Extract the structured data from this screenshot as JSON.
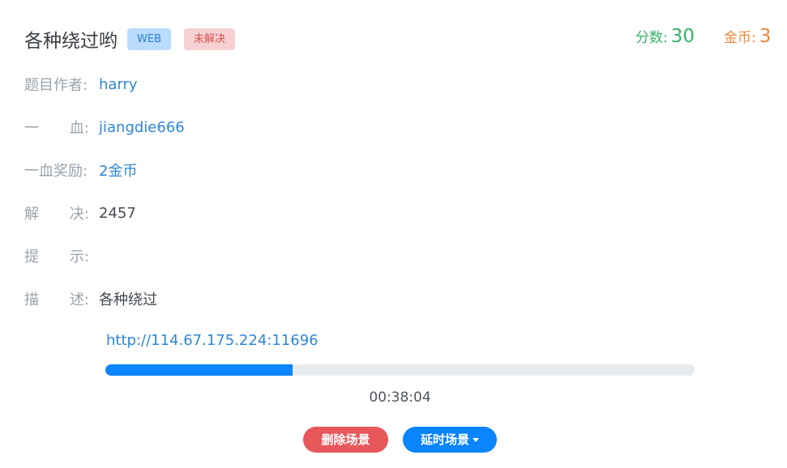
{
  "challenge": {
    "title": "各种绕过哟",
    "category_badge": "WEB",
    "status_badge": "未解决"
  },
  "stats": {
    "score_label": "分数:",
    "score_value": "30",
    "coin_label": "金币:",
    "coin_value": "3"
  },
  "info": [
    {
      "label_chars": [
        "题目作者:"
      ],
      "value": "harry",
      "style": "link"
    },
    {
      "label_chars": [
        "一",
        "血:"
      ],
      "value": "jiangdie666",
      "style": "link"
    },
    {
      "label_chars": [
        "一血奖励:"
      ],
      "value": "2金币",
      "style": "link"
    },
    {
      "label_chars": [
        "解",
        "决:"
      ],
      "value": "2457",
      "style": "plain"
    },
    {
      "label_chars": [
        "提",
        "示:"
      ],
      "value": "",
      "style": "plain"
    },
    {
      "label_chars": [
        "描",
        "述:"
      ],
      "value": "各种绕过",
      "style": "plain"
    }
  ],
  "scene": {
    "url": "http://114.67.175.224:11696",
    "progress_fraction": 0.318,
    "timer": "00:38:04",
    "delete_button": "删除场景",
    "extend_button": "延时场景"
  },
  "colors": {
    "accent": "#0a84ff",
    "score": "#35b36a",
    "coin": "#f0883e",
    "danger": "#e8575a"
  }
}
